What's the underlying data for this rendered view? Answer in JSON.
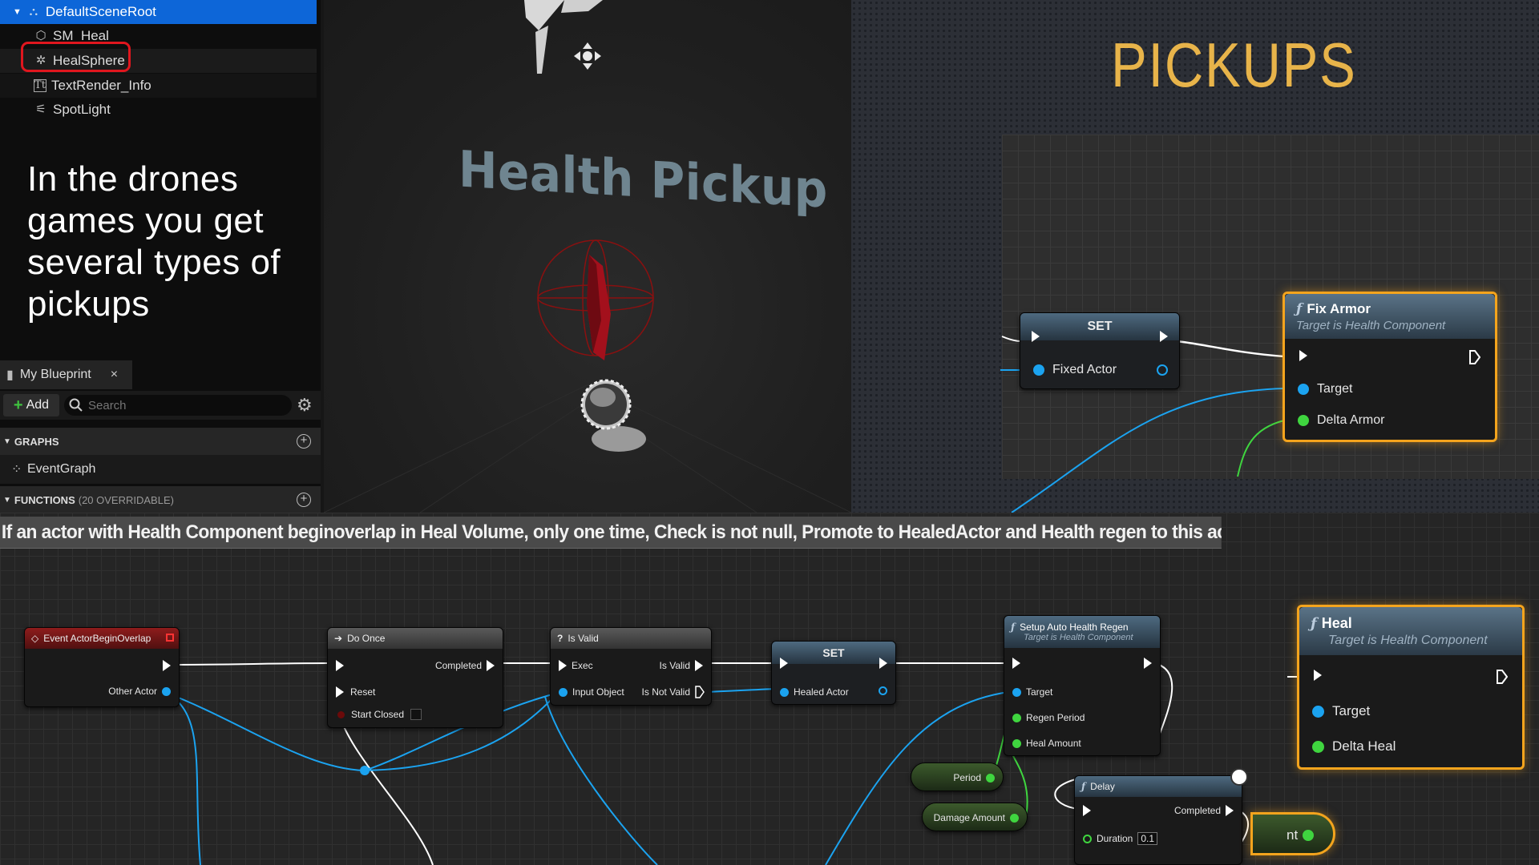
{
  "component_tree": {
    "root": "DefaultSceneRoot",
    "items": [
      "SM_Heal",
      "HealSphere",
      "TextRender_Info",
      "SpotLight"
    ]
  },
  "caption": "In the drones games you get several types of pickups",
  "my_blueprint": {
    "tab_label": "My Blueprint",
    "close": "×",
    "add_label": "Add",
    "search_placeholder": "Search",
    "graphs_label": "GRAPHS",
    "event_graph": "EventGraph",
    "functions_label": "FUNCTIONS",
    "functions_count": "(20 OVERRIDABLE)"
  },
  "viewport": {
    "title": "Health Pickup"
  },
  "right_graph": {
    "title": "PICKUPS",
    "set_node": {
      "title": "SET",
      "pin": "Fixed Actor"
    },
    "fix_armor": {
      "title": "Fix Armor",
      "subtitle": "Target is Health Component",
      "pins": [
        "Target",
        "Delta Armor"
      ]
    }
  },
  "comment": "If an actor with Health Component beginoverlap in Heal Volume, only one time, Check is not null, Promote to HealedActor and  Health regen to this  actor.",
  "nodes": {
    "event": {
      "title": "Event ActorBeginOverlap",
      "pin": "Other Actor"
    },
    "do_once": {
      "title": "Do Once",
      "completed": "Completed",
      "reset": "Reset",
      "start_closed": "Start Closed"
    },
    "is_valid": {
      "title": "Is Valid",
      "exec": "Exec",
      "is_valid": "Is Valid",
      "input": "Input Object",
      "not_valid": "Is Not Valid"
    },
    "set": {
      "title": "SET",
      "pin": "Healed Actor"
    },
    "regen": {
      "title": "Setup Auto Health Regen",
      "subtitle": "Target is Health Component",
      "target": "Target",
      "period": "Regen Period",
      "amount": "Heal Amount"
    },
    "period_var": "Period",
    "damage_var": "Damage Amount",
    "delay": {
      "title": "Delay",
      "completed": "Completed",
      "duration": "Duration",
      "duration_value": "0.1"
    },
    "heal": {
      "title": "Heal",
      "subtitle": "Target is Health Component",
      "target": "Target",
      "delta": "Delta Heal"
    },
    "partial": "nt"
  },
  "colors": {
    "selection": "#0d66d8",
    "highlight": "#f4a41d",
    "title": "#e8b44a",
    "exec_wire": "#ffffff",
    "object_wire": "#1ba3f0",
    "float_wire": "#3fd53f"
  }
}
